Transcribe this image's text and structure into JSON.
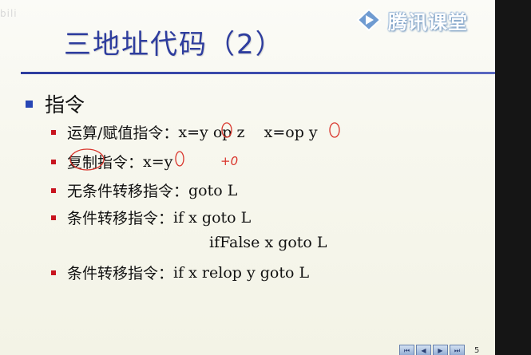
{
  "watermark": "bili",
  "brand": {
    "name": "腾讯课堂"
  },
  "slide": {
    "title": "三地址代码（2）",
    "section": "指令",
    "items": [
      {
        "label": "运算/赋值指令：",
        "code": "x=y op z    x=op y"
      },
      {
        "label": "复制指令：",
        "code": "x=y"
      },
      {
        "label": "无条件转移指令：",
        "code": "goto L"
      },
      {
        "label": "条件转移指令：",
        "code": "if x goto L"
      },
      {
        "label": "条件转移指令：",
        "code": "if x relop y goto L"
      }
    ],
    "continuation": "ifFalse x goto L",
    "handwritten_note": "+0",
    "page_number": "5"
  },
  "colors": {
    "title": "#2e3d9e",
    "rule": "#2e3d9e",
    "bullet1": "#2746b5",
    "bullet2": "#c8141e",
    "annotation": "#d9342b"
  },
  "nav_icons": [
    "first-icon",
    "prev-icon",
    "next-icon",
    "last-icon"
  ]
}
